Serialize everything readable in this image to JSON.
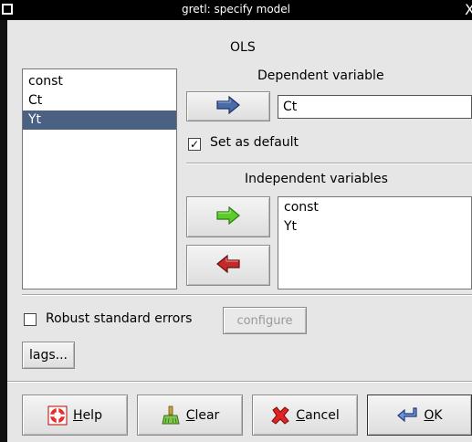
{
  "window": {
    "title": "gretl: specify model",
    "close_glyph": "X"
  },
  "estimator": "OLS",
  "available_vars": [
    "const",
    "Ct",
    "Yt"
  ],
  "selected_available_index": 2,
  "dependent": {
    "heading": "Dependent variable",
    "value": "Ct",
    "set_default_label": "Set as default",
    "set_default_checked": true
  },
  "independent": {
    "heading": "Independent variables",
    "vars": [
      "const",
      "Yt"
    ]
  },
  "options": {
    "robust_label": "Robust standard errors",
    "robust_checked": false,
    "configure_label": "configure",
    "lags_label": "lags..."
  },
  "buttons": {
    "help": {
      "mnemonic": "H",
      "rest": "elp"
    },
    "clear": {
      "mnemonic": "C",
      "rest": "lear"
    },
    "cancel": {
      "mnemonic": "C",
      "rest": "ancel"
    },
    "ok": {
      "mnemonic": "O",
      "rest": "K"
    }
  },
  "icons": {
    "arrow_blue": "arrow-right-icon",
    "arrow_green": "add-arrow-right-icon",
    "arrow_red": "remove-arrow-left-icon"
  },
  "colors": {
    "selection": "#4a6184",
    "arrow_blue": "#4a6aa8",
    "arrow_green": "#5ccc2a",
    "arrow_red": "#c42a2a"
  }
}
